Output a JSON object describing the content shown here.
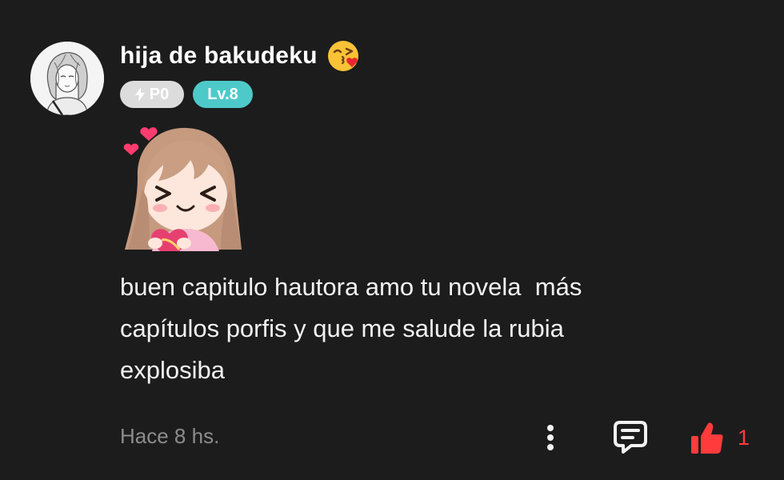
{
  "comment": {
    "username": "hija de bakudeku",
    "username_emoji_icon": "face-blowing-kiss-icon",
    "badges": {
      "points_icon": "lightning-bolt-icon",
      "points_label": "P0",
      "level_label": "Lv.8"
    },
    "sticker_icon": "anime-girl-heart-sticker",
    "text": "buen capitulo hautora amo tu novela  más\ncapítulos porfis y que me salude la rubia\nexplosiba",
    "timestamp": "Hace 8 hs.",
    "actions": {
      "more_icon": "vertical-dots-icon",
      "reply_icon": "comment-bubble-icon",
      "like_icon": "thumbs-up-icon",
      "like_count": "1"
    }
  },
  "colors": {
    "background": "#1c1c1d",
    "text": "#f2f2f2",
    "muted": "#8c8c8c",
    "points_badge": "#dcdcdc",
    "level_badge": "#4ec9c9",
    "like_accent": "#ff3b3b"
  }
}
